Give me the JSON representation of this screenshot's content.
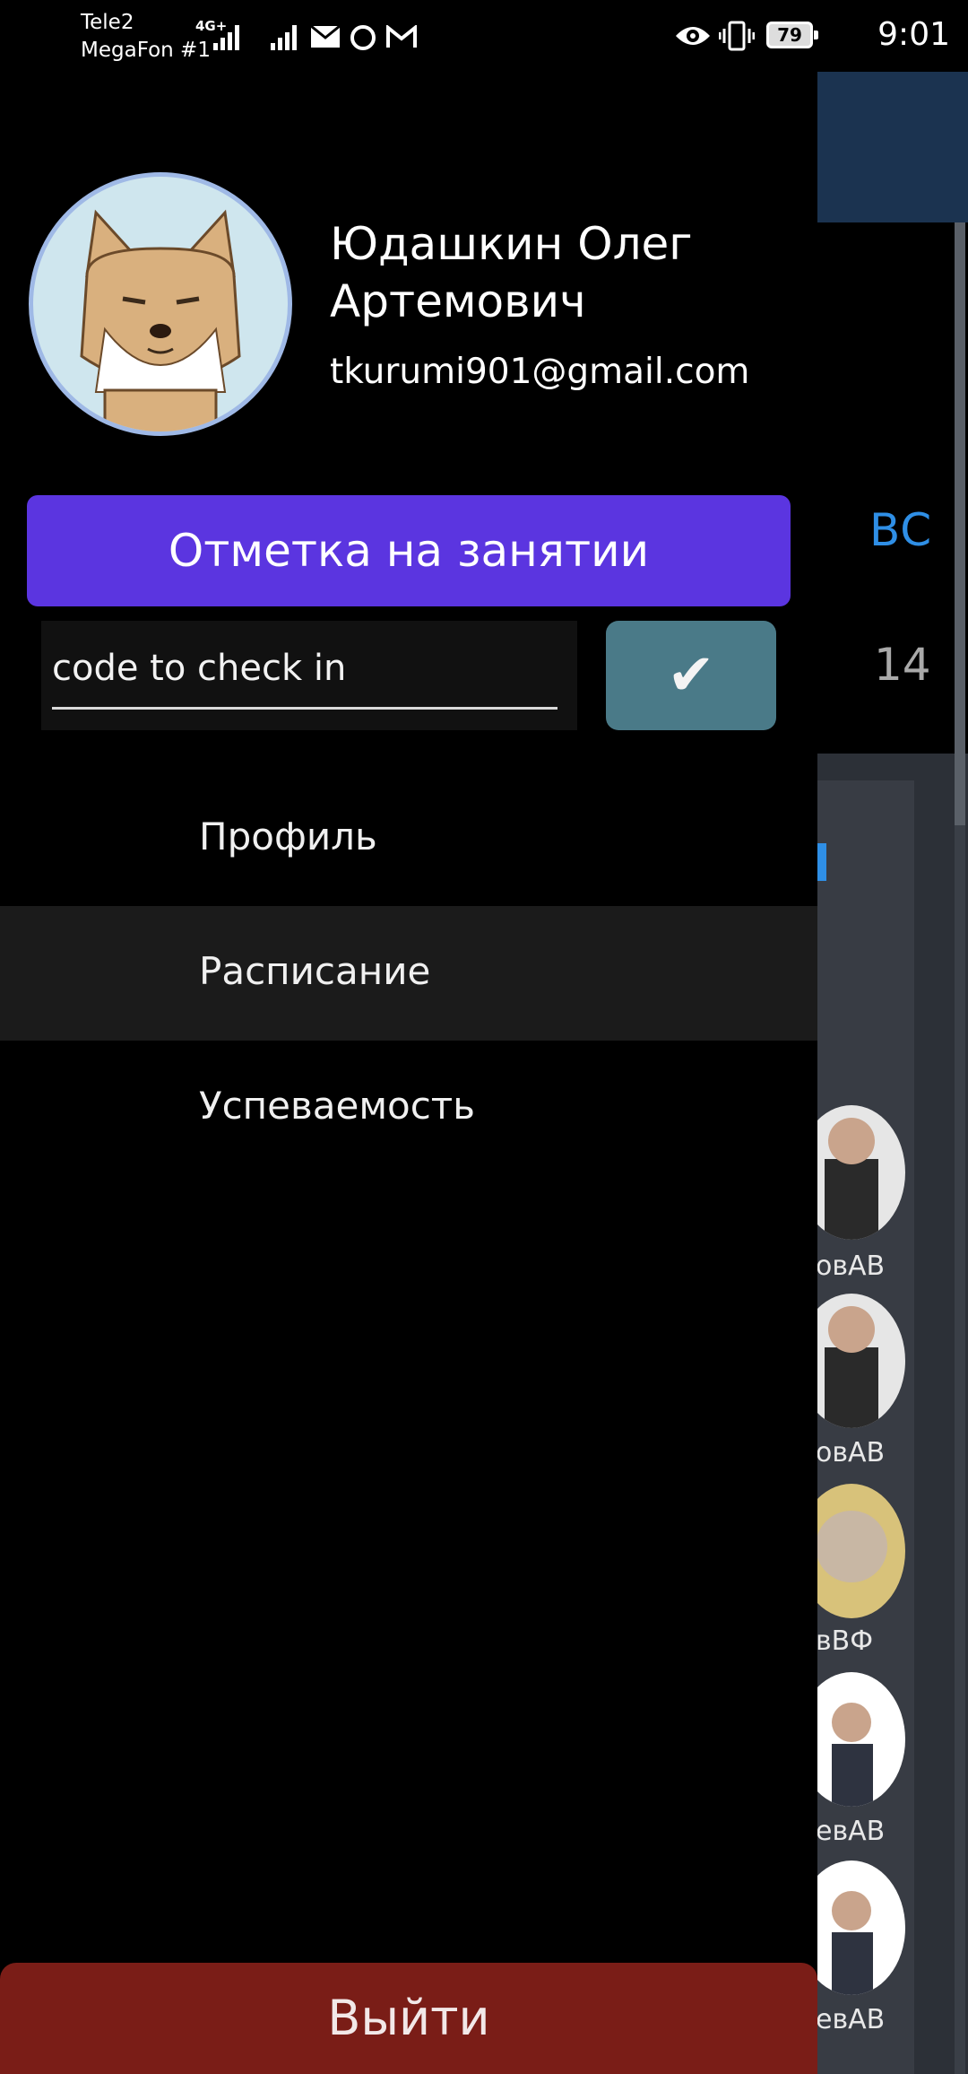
{
  "status_bar": {
    "carrier_1": "Tele2",
    "carrier_2": "MegaFon #1",
    "network_tag": "4G+",
    "battery": "79",
    "time": "9:01",
    "icons": [
      "signal-icon",
      "signal-icon",
      "mail-icon",
      "circle-icon",
      "gmail-icon",
      "eye-icon",
      "vibrate-icon",
      "battery-icon"
    ]
  },
  "background_app": {
    "day": "ВС",
    "date": "14",
    "teacher_fragments": [
      "овАВ",
      "овАВ",
      "вВФ",
      "евАВ",
      "евАВ"
    ],
    "header_color": "#1b3350"
  },
  "drawer": {
    "user": {
      "name": "Юдашкин Олег Артемович",
      "email": "tkurumi901@gmail.com",
      "avatar_icon": "shiba-dog-avatar"
    },
    "checkin": {
      "button_label": "Отметка на занятии",
      "code_value": "code to check in",
      "confirm_label": "✔"
    },
    "menu": [
      {
        "label": "Профиль",
        "active": false
      },
      {
        "label": "Расписание",
        "active": true
      },
      {
        "label": "Успеваемость",
        "active": false
      }
    ],
    "logout_label": "Выйти"
  },
  "colors": {
    "accent": "#5b35e0",
    "confirm": "#4a7a88",
    "logout": "#7a1d17",
    "link_blue": "#2f8fe6"
  }
}
